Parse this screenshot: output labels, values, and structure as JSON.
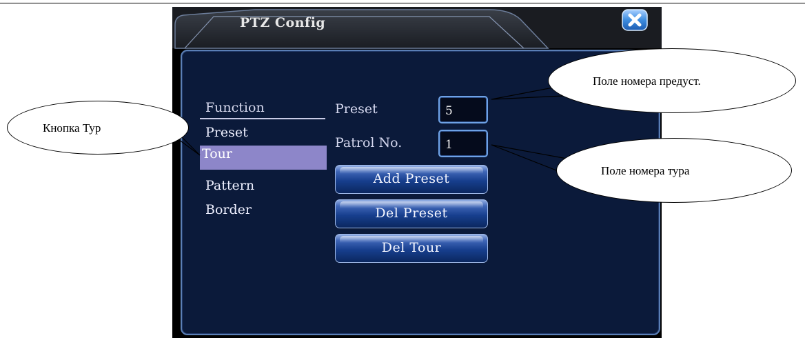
{
  "window": {
    "title": "PTZ Config"
  },
  "menu": {
    "header": "Function",
    "items": [
      {
        "label": "Preset"
      },
      {
        "label": "Tour"
      },
      {
        "label": "Pattern"
      },
      {
        "label": "Border"
      }
    ],
    "selected": "Tour"
  },
  "fields": {
    "preset": {
      "label": "Preset",
      "value": "5"
    },
    "patrol": {
      "label": "Patrol No.",
      "value": "1"
    }
  },
  "buttons": {
    "add_preset": "Add Preset",
    "del_preset": "Del Preset",
    "del_tour": "Del Tour"
  },
  "callouts": {
    "tour_button": "Кнопка Тур",
    "preset_field": "Поле номера предуст.",
    "tour_field": "Поле номера тура"
  },
  "icons": {
    "close": "close-x-icon"
  },
  "colors": {
    "panel": "#0b1a3a",
    "selected_item": "#8d86c9",
    "field_border": "#6ea2e6",
    "button": "#173f8e"
  }
}
